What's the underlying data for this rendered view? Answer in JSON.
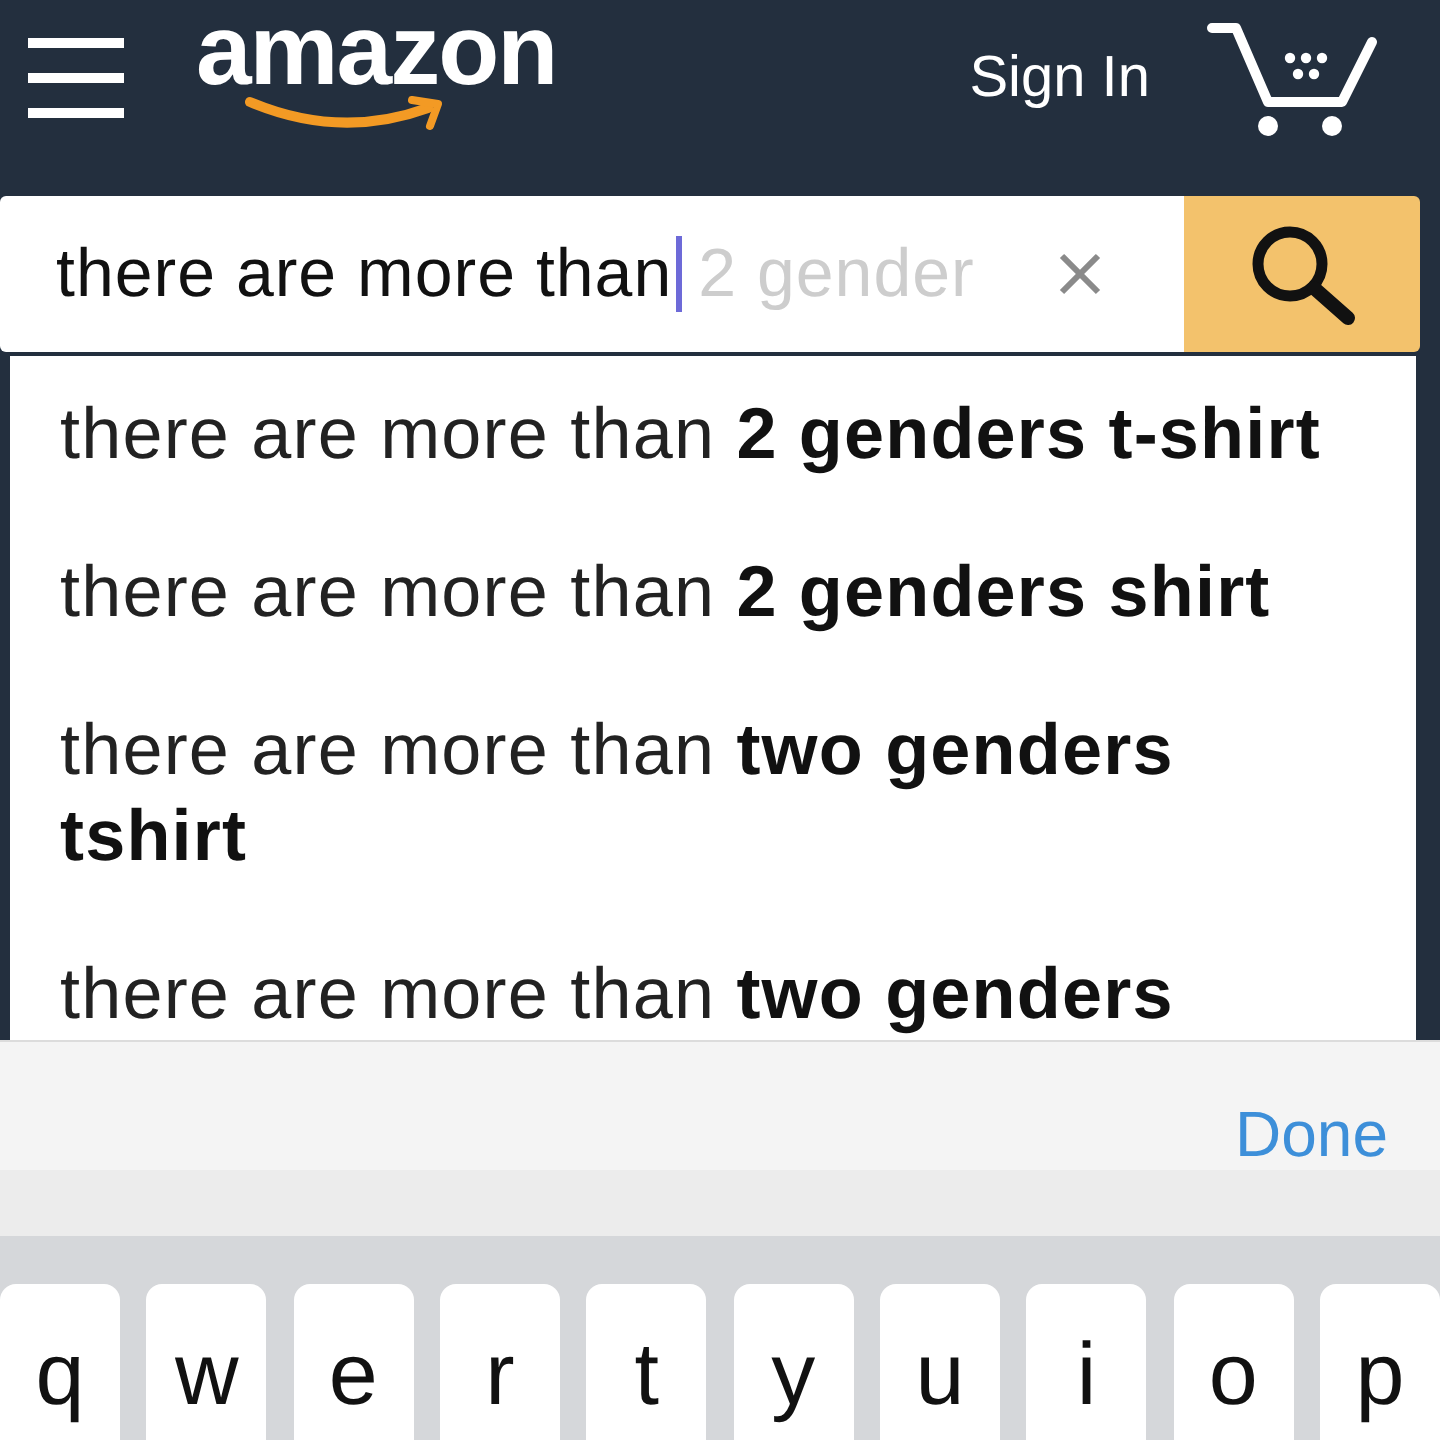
{
  "header": {
    "logo": "amazon",
    "sign_in": "Sign In"
  },
  "search": {
    "value": "there are more than",
    "focused": true,
    "completion": "2 gender"
  },
  "suggestions": [
    {
      "text": "there are more than **2 genders t-shirt**"
    },
    {
      "text": "there are more than **2 genders shirt**"
    },
    {
      "text": "there are more than **two genders tshirt**"
    },
    {
      "text": "there are more than **two genders**"
    }
  ],
  "keyboard_toolbar": {
    "done": "Done"
  },
  "keyboard": {
    "keys": [
      "q",
      "w",
      "e",
      "r",
      "t",
      "y",
      "u",
      "i",
      "o",
      "p"
    ]
  }
}
